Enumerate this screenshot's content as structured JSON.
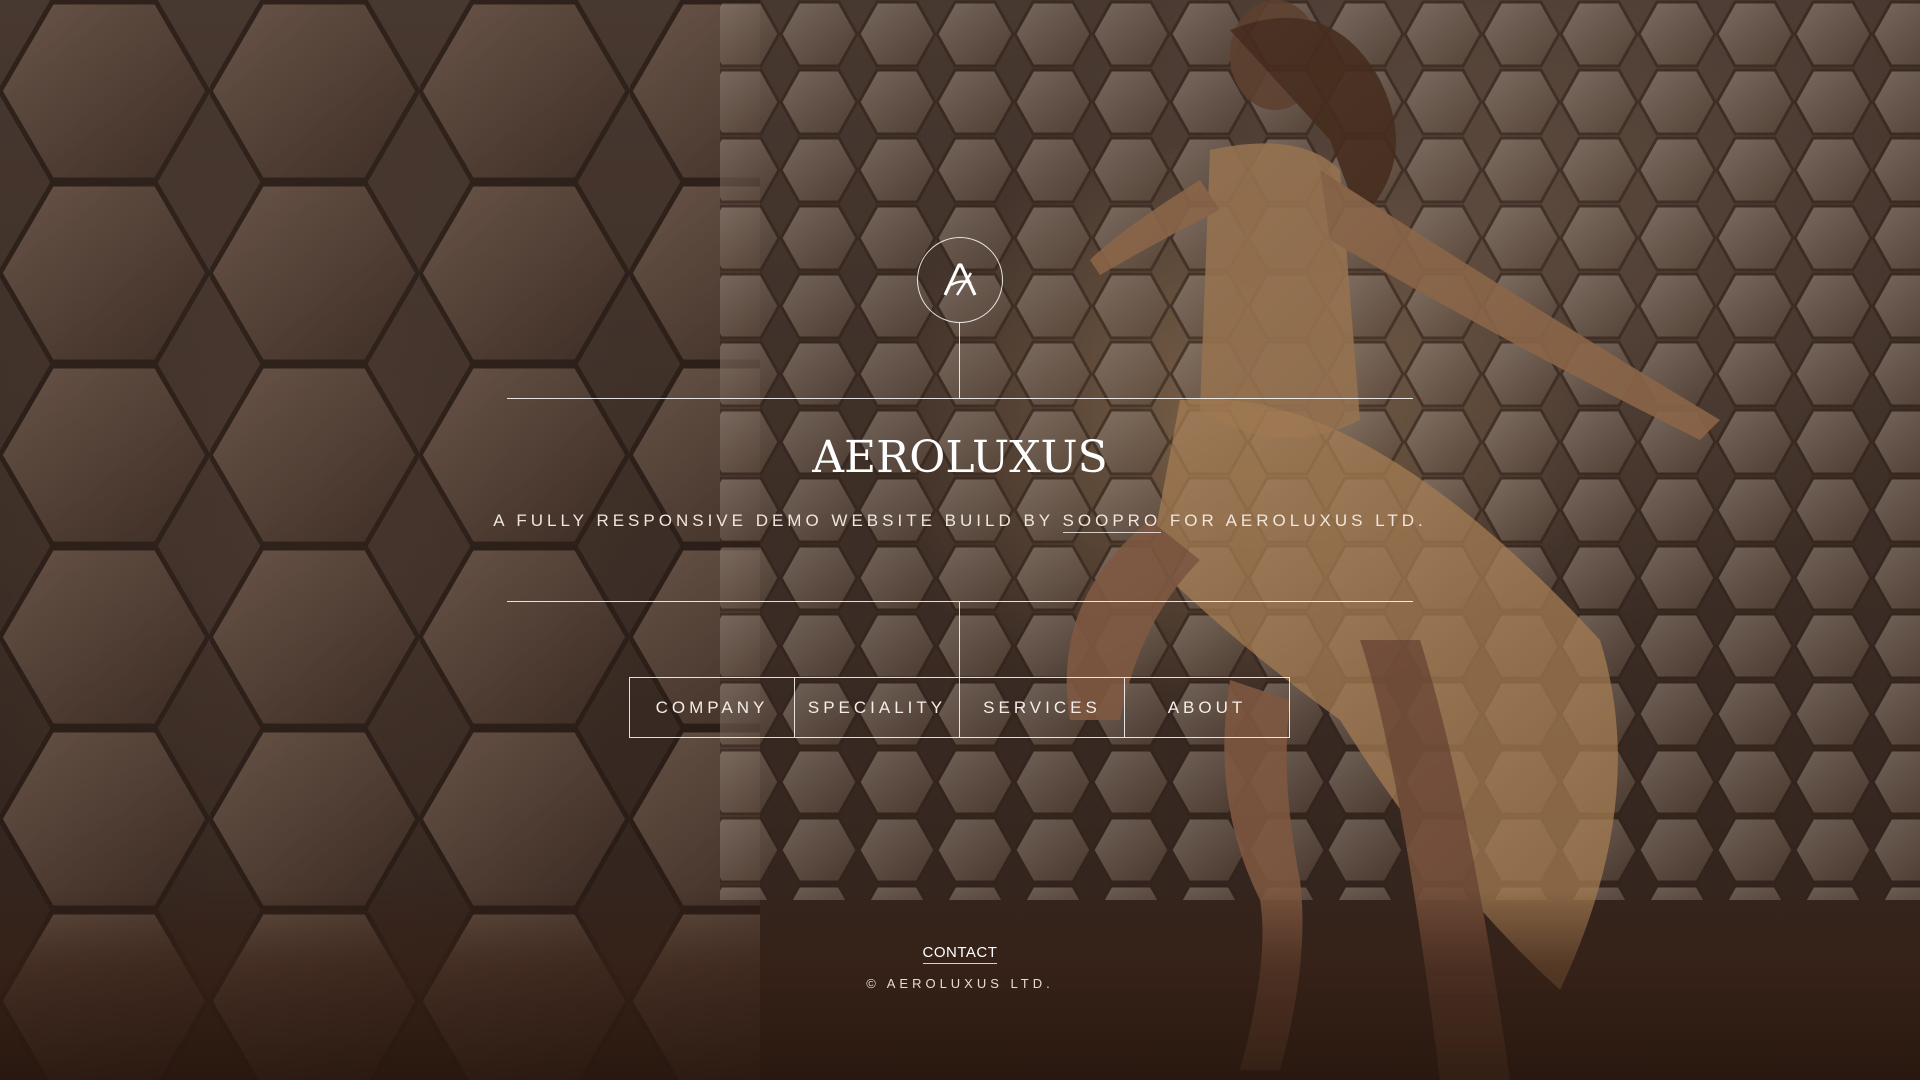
{
  "brand": {
    "logo_icon": "aeroluxus-monogram-icon",
    "title": "AEROLUXUS"
  },
  "tagline": {
    "prefix": "A FULLY RESPONSIVE DEMO WEBSITE BUILD BY",
    "link_text": "SOOPRO",
    "suffix": "FOR AEROLUXUS LTD."
  },
  "nav": {
    "items": [
      {
        "label": "COMPANY"
      },
      {
        "label": "SPECIALITY"
      },
      {
        "label": "SERVICES"
      },
      {
        "label": "ABOUT"
      }
    ]
  },
  "footer": {
    "contact_label": "CONTACT",
    "copyright": "© AEROLUXUS LTD."
  },
  "colors": {
    "line": "#ffffff",
    "text": "#f3ece6",
    "background_tone": "#4a3a30"
  }
}
